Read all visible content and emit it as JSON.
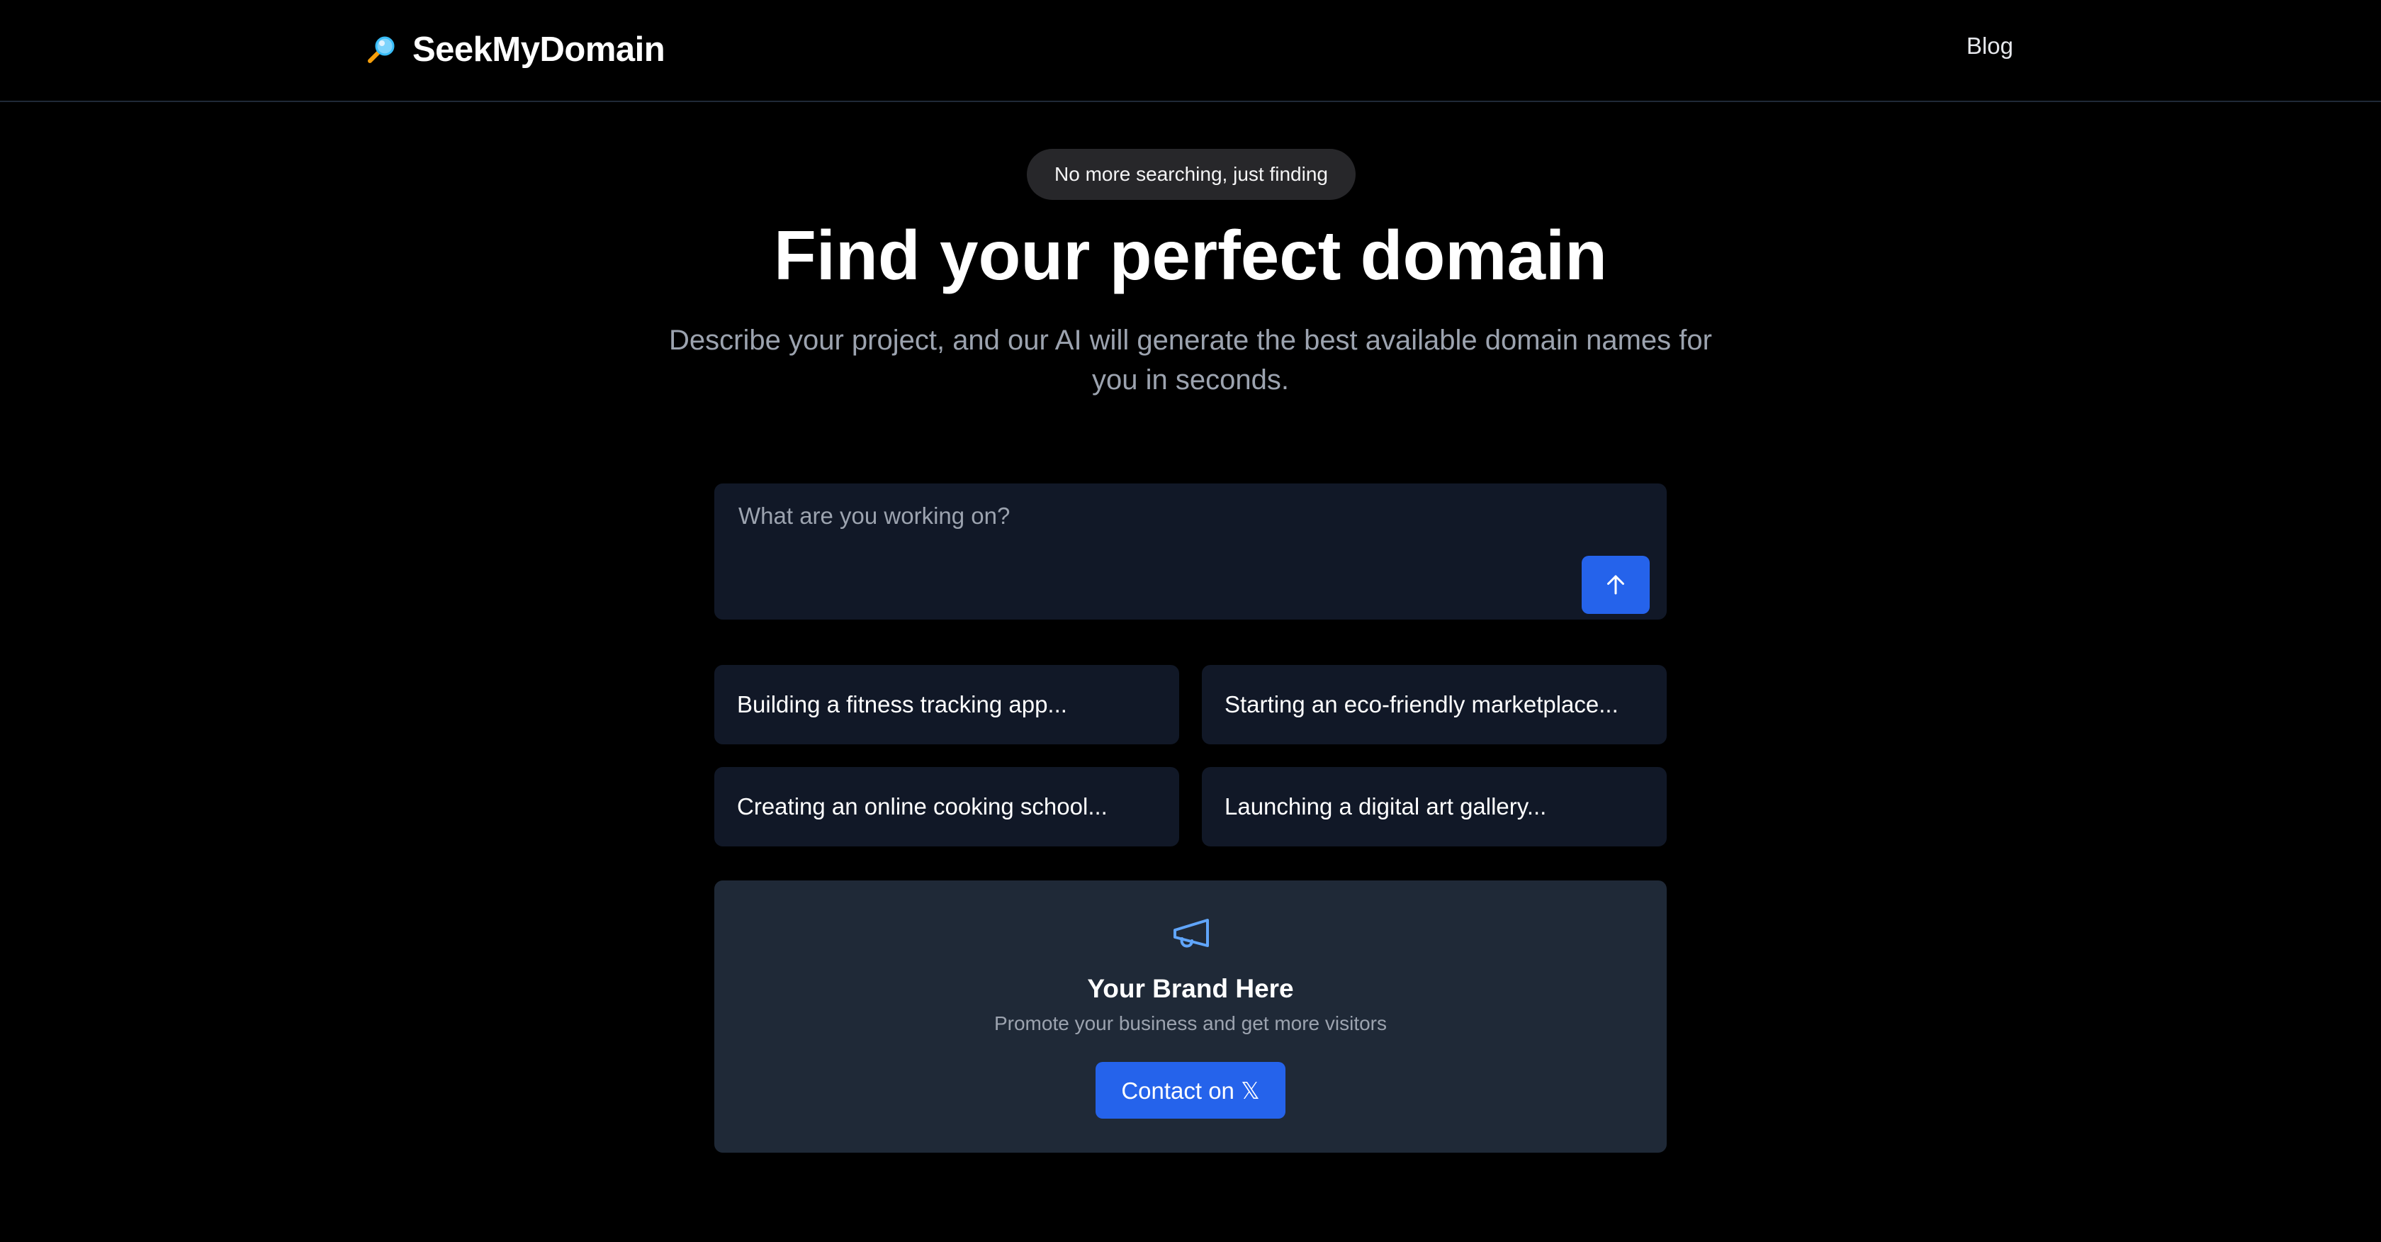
{
  "header": {
    "brand": "SeekMyDomain",
    "brand_icon": "magnifying-glass-icon",
    "nav": {
      "blog_label": "Blog"
    }
  },
  "hero": {
    "badge": "No more searching, just finding",
    "title": "Find your perfect domain",
    "subtitle": "Describe your project, and our AI will generate the best available domain names for you in seconds."
  },
  "prompt": {
    "placeholder": "What are you working on?",
    "value": "",
    "submit_icon": "arrow-up-icon"
  },
  "suggestions": [
    {
      "label": "Building a fitness tracking app..."
    },
    {
      "label": "Starting an eco-friendly marketplace..."
    },
    {
      "label": "Creating an online cooking school..."
    },
    {
      "label": "Launching a digital art gallery..."
    }
  ],
  "ad": {
    "icon": "megaphone-icon",
    "title": "Your Brand Here",
    "subtitle": "Promote your business and get more visitors",
    "button_label": "Contact on 𝕏"
  },
  "colors": {
    "background": "#000000",
    "accent": "#2563eb",
    "card": "#111827",
    "ad_card": "#1f2937",
    "muted_text": "#9ca3af"
  }
}
